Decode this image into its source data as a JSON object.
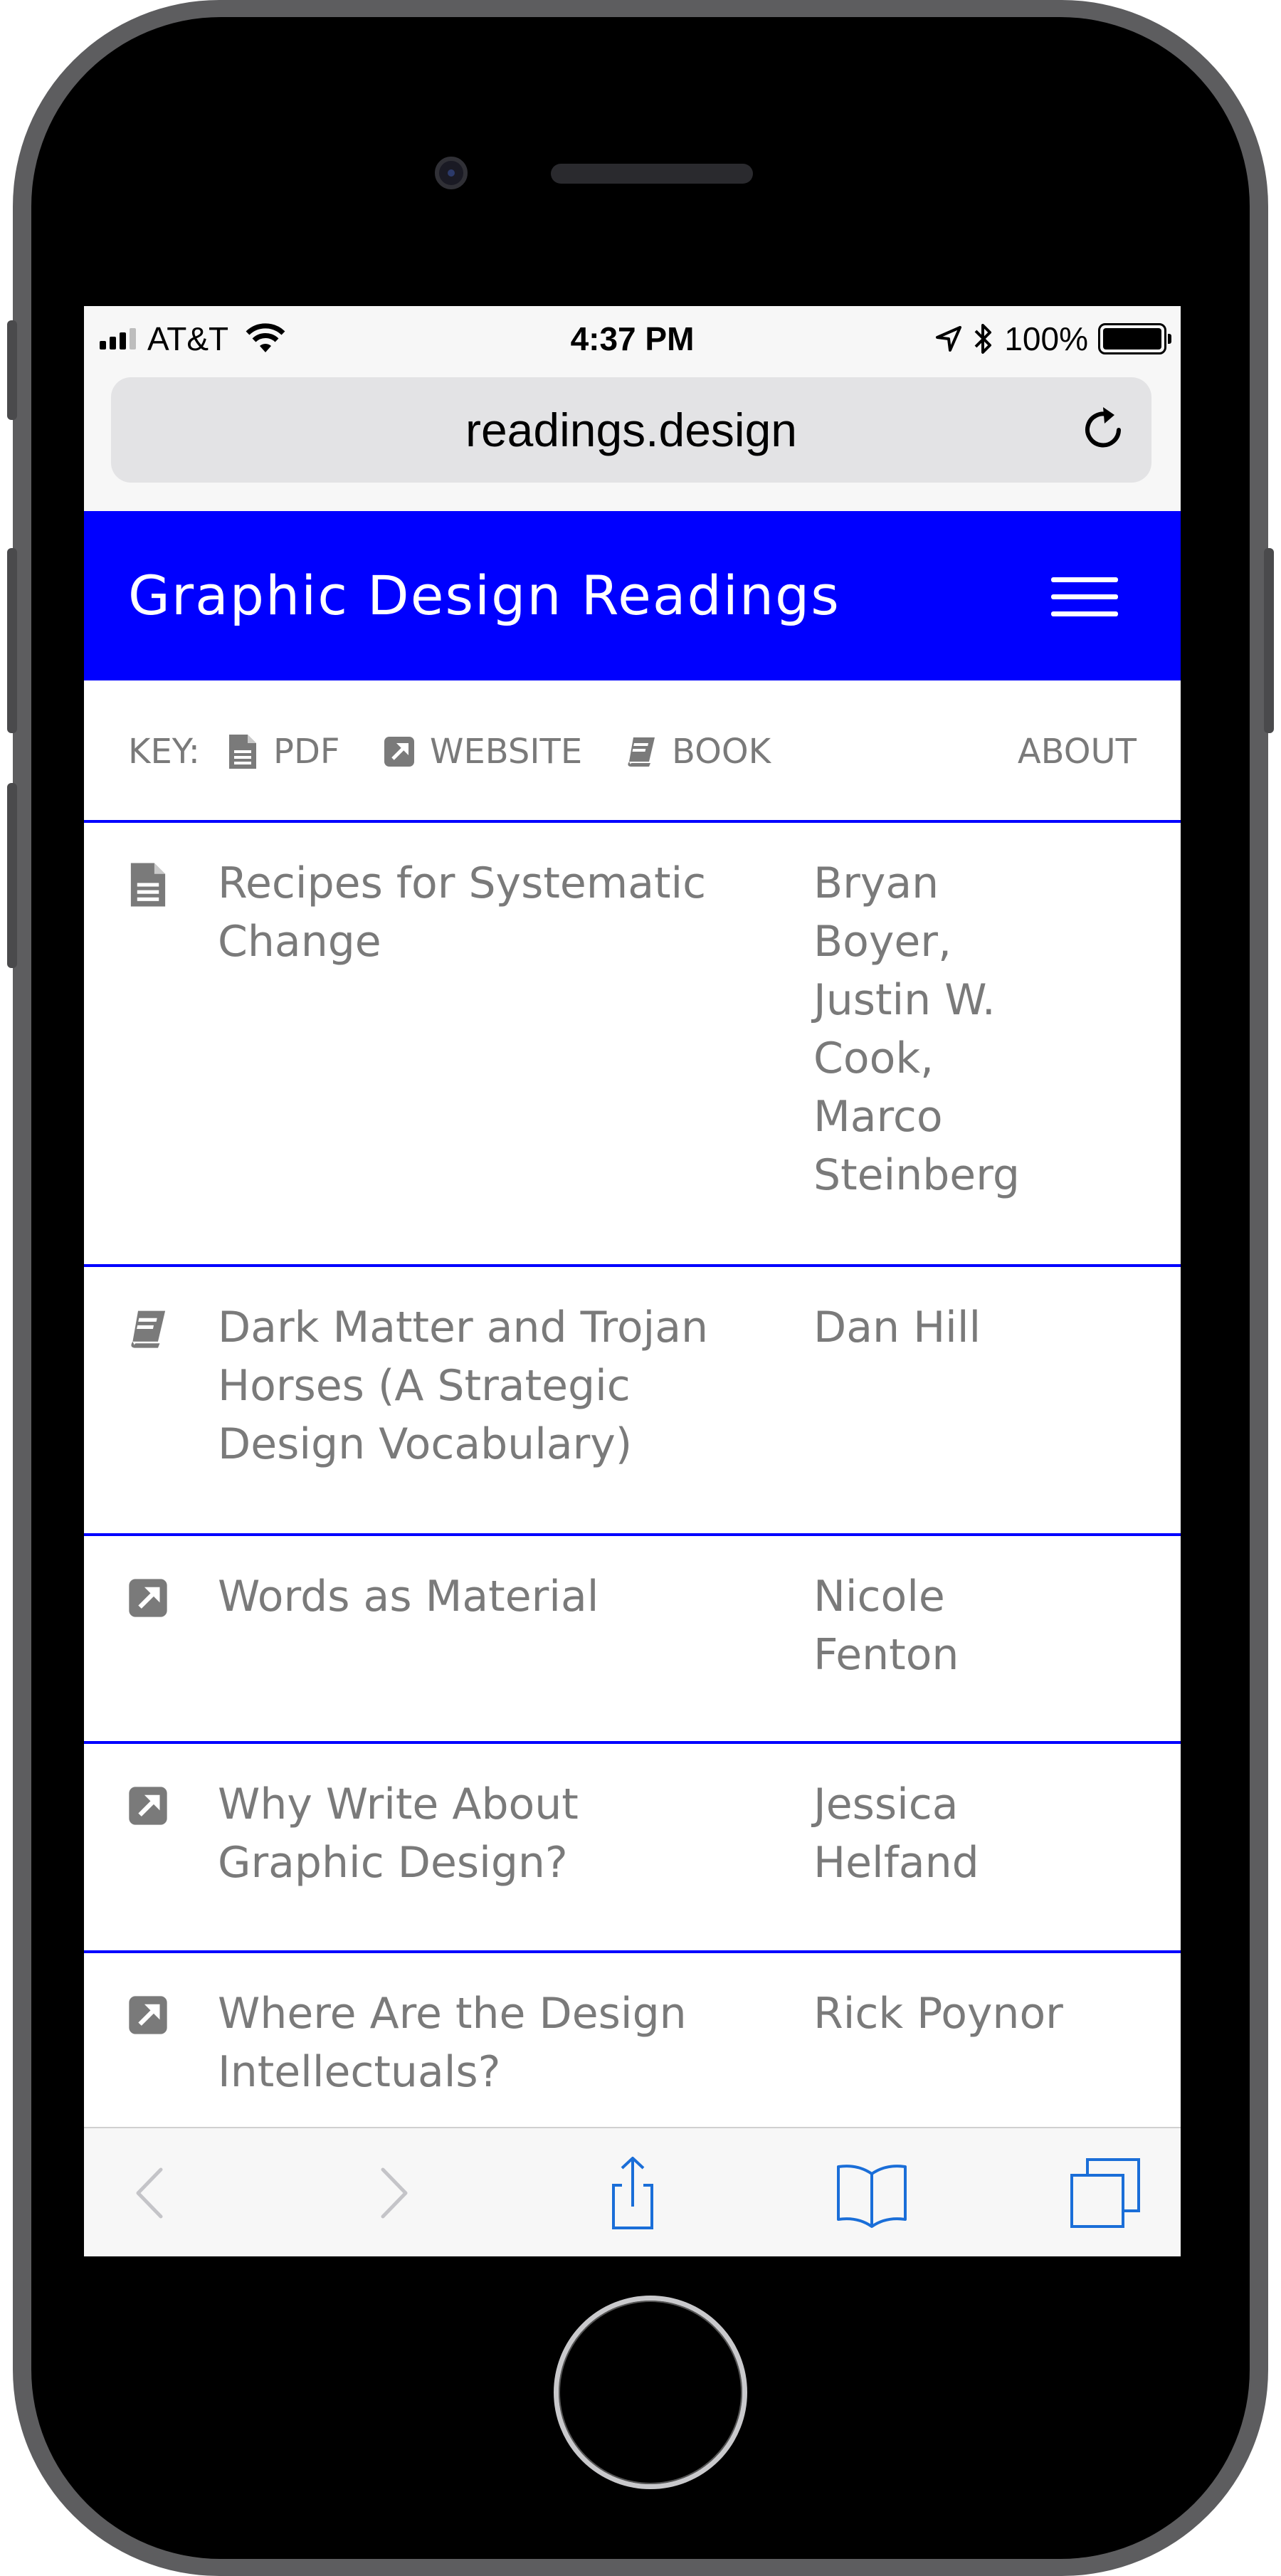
{
  "status_bar": {
    "carrier": "AT&T",
    "time": "4:37 PM",
    "battery": "100%"
  },
  "browser": {
    "url": "readings.design"
  },
  "site": {
    "title": "Graphic Design Readings",
    "accent_color": "#0000ff"
  },
  "key": {
    "label": "KEY:",
    "pdf": "PDF",
    "website": "WEBSITE",
    "book": "BOOK",
    "about": "ABOUT"
  },
  "readings": [
    {
      "type": "pdf",
      "icon": "pdf-icon",
      "title": "Recipes for Systematic Change",
      "author": "Bryan Boyer, Justin W. Cook, Marco Steinberg"
    },
    {
      "type": "book",
      "icon": "book-icon",
      "title": "Dark Matter and Trojan Horses (A Strategic Design Vocabulary)",
      "author": "Dan Hill"
    },
    {
      "type": "website",
      "icon": "external-link-icon",
      "title": "Words as Material",
      "author": "Nicole Fenton"
    },
    {
      "type": "website",
      "icon": "external-link-icon",
      "title": "Why Write About Graphic Design?",
      "author": "Jessica Helfand"
    },
    {
      "type": "website",
      "icon": "external-link-icon",
      "title": "Where Are the Design Intellectuals?",
      "author": "Rick Poynor"
    }
  ],
  "toolbar": {
    "items": [
      "back-icon",
      "forward-icon",
      "share-icon",
      "bookmarks-icon",
      "tabs-icon"
    ]
  }
}
